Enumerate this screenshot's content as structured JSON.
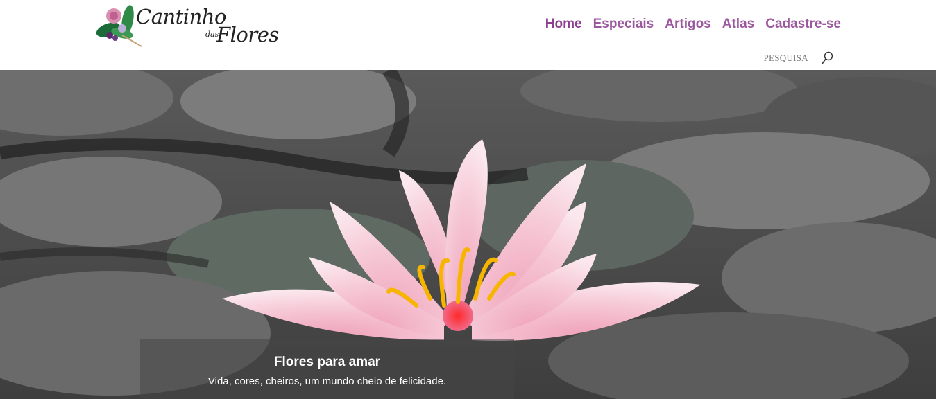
{
  "brand": {
    "line1": "Cantinho",
    "small": "das",
    "line2": "Flores"
  },
  "nav": {
    "items": [
      {
        "label": "Home",
        "active": true
      },
      {
        "label": "Especiais"
      },
      {
        "label": "Artigos"
      },
      {
        "label": "Atlas"
      },
      {
        "label": "Cadastre-se"
      }
    ]
  },
  "search": {
    "placeholder": "PESQUISA",
    "icon": "search-icon"
  },
  "hero": {
    "caption_title": "Flores para amar",
    "caption_subtitle": "Vida, cores, cheiros, um mundo cheio de felicidade."
  },
  "colors": {
    "nav": "#9b589e",
    "caption_bg": "rgba(70,70,70,0.55)"
  }
}
